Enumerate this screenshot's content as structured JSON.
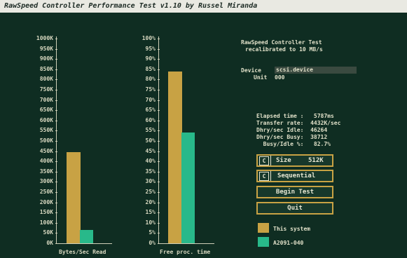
{
  "window": {
    "title": "RawSpeed Controller Performance Test v1.10 by Russel Miranda"
  },
  "chart1": {
    "ticks": [
      "1000K",
      "950K",
      "900K",
      "850K",
      "800K",
      "750K",
      "700K",
      "650K",
      "600K",
      "550K",
      "500K",
      "450K",
      "400K",
      "350K",
      "300K",
      "250K",
      "200K",
      "150K",
      "100K",
      "50K",
      "0K"
    ],
    "xlabel": "Bytes/Sec Read"
  },
  "chart2": {
    "ticks": [
      "100%",
      "95%",
      "90%",
      "85%",
      "80%",
      "75%",
      "70%",
      "65%",
      "60%",
      "55%",
      "50%",
      "45%",
      "40%",
      "35%",
      "30%",
      "25%",
      "20%",
      "15%",
      "10%",
      "5%",
      "0%"
    ],
    "xlabel": "Free proc. time"
  },
  "chart_data": [
    {
      "type": "bar",
      "xlabel": "Bytes/Sec Read",
      "ylim": [
        0,
        1000
      ],
      "series": [
        {
          "name": "This system",
          "values": [
            445
          ]
        },
        {
          "name": "A2091-040",
          "values": [
            65
          ]
        }
      ]
    },
    {
      "type": "bar",
      "xlabel": "Free proc. time",
      "ylim": [
        0,
        100
      ],
      "series": [
        {
          "name": "This system",
          "values": [
            84
          ]
        },
        {
          "name": "A2091-040",
          "values": [
            54
          ]
        }
      ]
    }
  ],
  "header": {
    "line1": "RawSpeed Controller Test",
    "line2": "recalibrated to 10 MB/s"
  },
  "device": {
    "label": "Device",
    "value": "scsi.device",
    "unit_label": "Unit",
    "unit_value": "000"
  },
  "stats": {
    "elapsed": "Elapsed time :   5787ms",
    "transfer": "Transfer rate:  4432K/sec",
    "idle": "Dhry/sec Idle:  46264",
    "busy": "Dhry/sec Busy:  38712",
    "ratio": "  Busy/Idle %:   82.7%"
  },
  "buttons": {
    "size_check": "C",
    "size_label": "Size",
    "size_value": "512K",
    "seq_check": "C",
    "seq_label": "Sequential",
    "begin": "Begin Test",
    "quit": "Quit"
  },
  "legend": {
    "item1": "This system",
    "item2": "A2091-040",
    "color1": "#c8a244",
    "color2": "#28b98a"
  }
}
